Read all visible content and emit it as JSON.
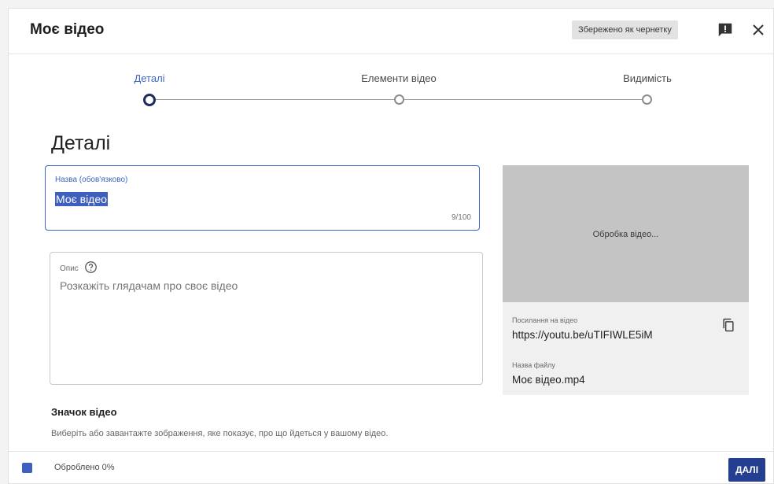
{
  "header": {
    "title": "Моє відео",
    "saved_badge": "Збережено як чернетку"
  },
  "stepper": {
    "steps": [
      {
        "label": "Деталі",
        "active": true
      },
      {
        "label": "Елементи відео",
        "active": false
      },
      {
        "label": "Видимість",
        "active": false
      }
    ]
  },
  "details": {
    "section_title": "Деталі",
    "title_field": {
      "label": "Назва (обов'язково)",
      "value": "Моє відео",
      "char_count": "9/100"
    },
    "description_field": {
      "label": "Опис",
      "placeholder": "Розкажіть глядачам про своє відео"
    },
    "thumbnail": {
      "heading": "Значок відео",
      "description": "Виберіть або завантажте зображення, яке показує, про що йдеться у вашому відео."
    }
  },
  "preview": {
    "processing_text": "Обробка відео...",
    "link_label": "Посилання на відео",
    "link_value": "https://youtu.be/uTIFIWLE5iM",
    "file_label": "Назва файлу",
    "file_value": "Моє відео.mp4"
  },
  "footer": {
    "status_text": "Оброблено 0%",
    "next_label": "ДАЛІ"
  },
  "colors": {
    "accent": "#3d66c4",
    "primary_button": "#243f8f"
  }
}
